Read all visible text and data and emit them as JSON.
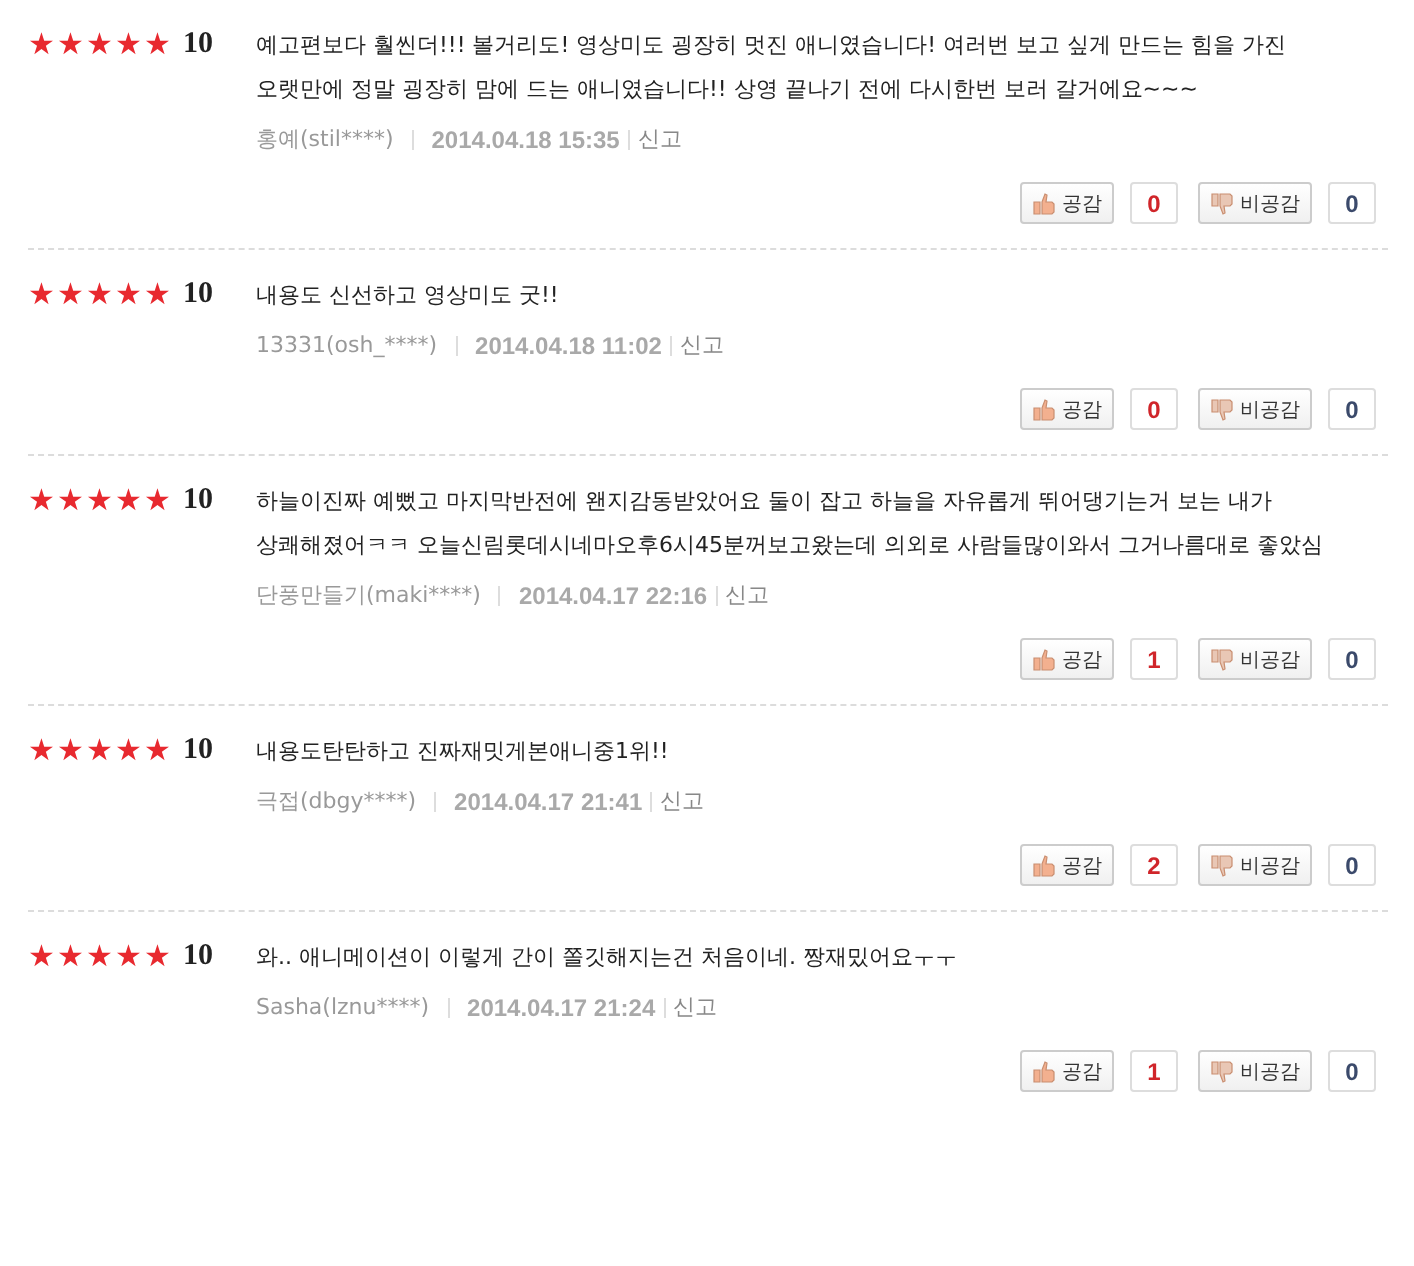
{
  "reviews": [
    {
      "stars": 5,
      "score": "10",
      "text": "예고편보다 훨씬더!!! 볼거리도! 영상미도 굉장히 멋진 애니였습니다! 여러번 보고 싶게 만드는 힘을 가진 오랫만에 정말 굉장히 맘에 드는 애니였습니다!! 상영 끝나기 전에 다시한번 보러 갈거에요~~~",
      "author": "홍예(stil****)",
      "date": "2014.04.18 15:35",
      "report": "신고",
      "like_label": "공감",
      "likes": "0",
      "dislike_label": "비공감",
      "dislikes": "0"
    },
    {
      "stars": 5,
      "score": "10",
      "text": "내용도 신선하고 영상미도 굿!!",
      "author": "13331(osh_****)",
      "date": "2014.04.18 11:02",
      "report": "신고",
      "like_label": "공감",
      "likes": "0",
      "dislike_label": "비공감",
      "dislikes": "0"
    },
    {
      "stars": 5,
      "score": "10",
      "text": "하늘이진짜 예뻤고 마지막반전에 왠지감동받았어요 둘이 잡고 하늘을 자유롭게 뛰어댕기는거 보는 내가 상쾌해졌어ㅋㅋ 오늘신림롯데시네마오후6시45분꺼보고왔는데 의외로 사람들많이와서 그거나름대로 좋았심",
      "author": "단풍만들기(maki****)",
      "date": "2014.04.17 22:16",
      "report": "신고",
      "like_label": "공감",
      "likes": "1",
      "dislike_label": "비공감",
      "dislikes": "0"
    },
    {
      "stars": 5,
      "score": "10",
      "text": "내용도탄탄하고 진짜재밋게본애니중1위!!",
      "author": "극접(dbgy****)",
      "date": "2014.04.17 21:41",
      "report": "신고",
      "like_label": "공감",
      "likes": "2",
      "dislike_label": "비공감",
      "dislikes": "0"
    },
    {
      "stars": 5,
      "score": "10",
      "text": "와.. 애니메이션이 이렇게 간이 쫄깃해지는건 처음이네. 짱재밌어요ㅜㅜ",
      "author": "Sasha(lznu****)",
      "date": "2014.04.17 21:24",
      "report": "신고",
      "like_label": "공감",
      "likes": "1",
      "dislike_label": "비공감",
      "dislikes": "0"
    }
  ]
}
